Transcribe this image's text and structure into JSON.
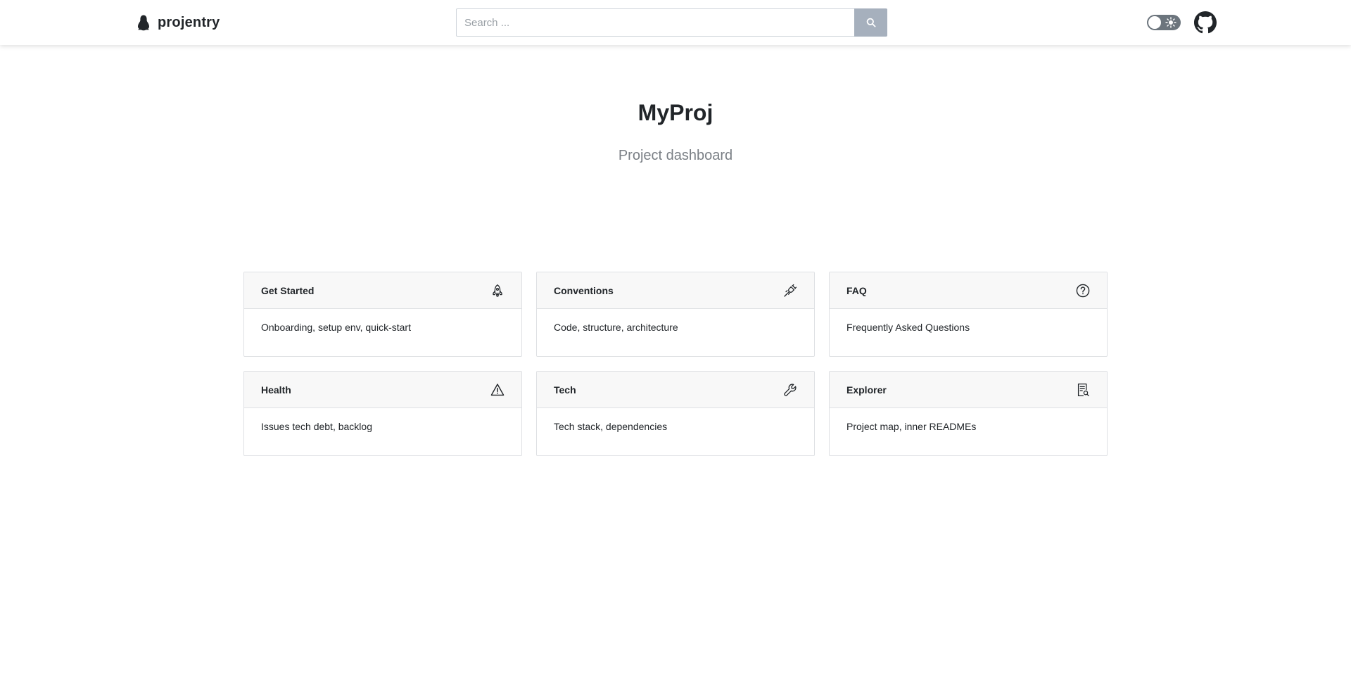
{
  "navbar": {
    "brand_icon": "penguin-icon",
    "brand_text": "projentry",
    "search": {
      "placeholder": "Search ...",
      "value": "",
      "button_icon": "search-icon"
    },
    "theme_toggle": {
      "icon": "sun-icon",
      "state": "light"
    },
    "github_icon": "github-icon"
  },
  "hero": {
    "title": "MyProj",
    "subtitle": "Project dashboard"
  },
  "cards": [
    {
      "title": "Get Started",
      "description": "Onboarding, setup env, quick-start",
      "icon": "rocket-icon"
    },
    {
      "title": "Conventions",
      "description": "Code, structure, architecture",
      "icon": "plug-icon"
    },
    {
      "title": "FAQ",
      "description": "Frequently Asked Questions",
      "icon": "question-circle-icon"
    },
    {
      "title": "Health",
      "description": "Issues tech debt, backlog",
      "icon": "warning-triangle-icon"
    },
    {
      "title": "Tech",
      "description": "Tech stack, dependencies",
      "icon": "wrench-icon"
    },
    {
      "title": "Explorer",
      "description": "Project map, inner READMEs",
      "icon": "file-search-icon"
    }
  ],
  "colors": {
    "search_button_bg": "#a6b0bd",
    "card_header_bg": "#f8f8f8",
    "card_border": "#dfe1e4",
    "subtitle": "#7a7f85",
    "toggle_bg": "#6c757d"
  }
}
